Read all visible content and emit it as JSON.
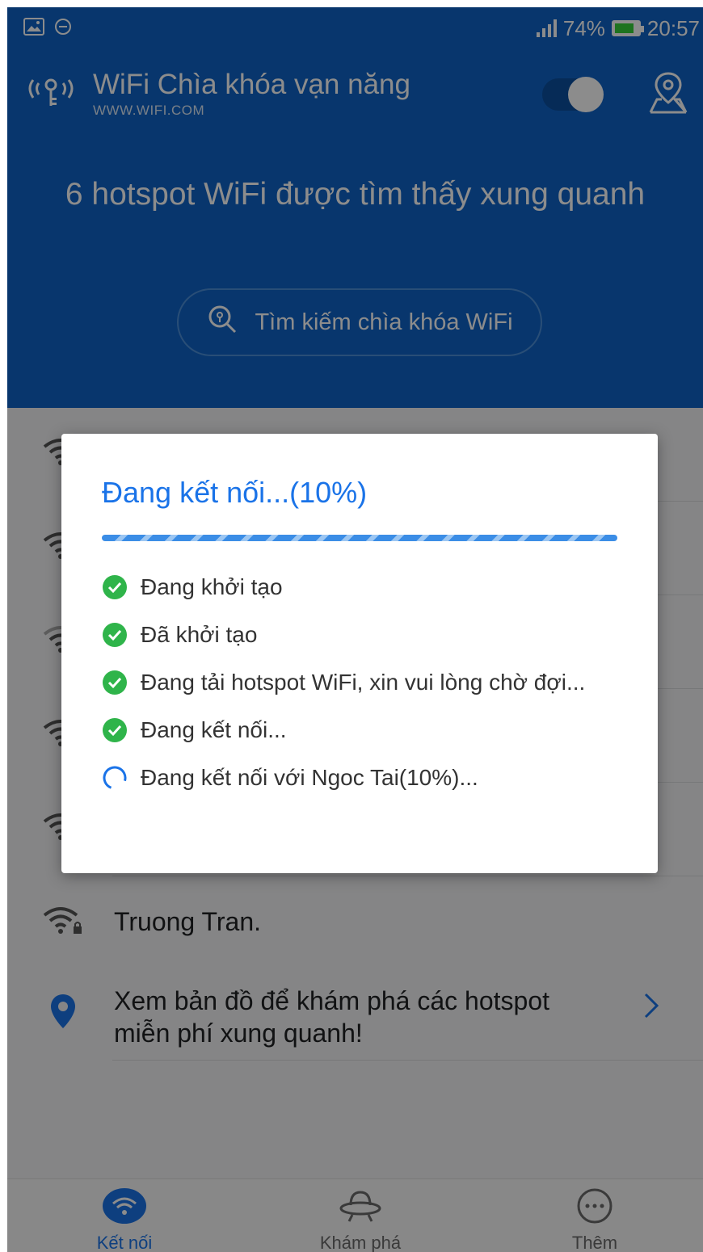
{
  "status_bar": {
    "battery": "74%",
    "time": "20:57"
  },
  "app": {
    "title": "WiFi Chìa khóa vạn năng",
    "subtitle": "WWW.WIFI.COM",
    "toggle_on": true
  },
  "hero": {
    "hotspot_count": "6 hotspot WiFi được tìm thấy xung quanh",
    "search_button": "Tìm kiếm chìa khóa WiFi"
  },
  "list": {
    "visible_network": "Truong Tran.",
    "map_prompt_line1": "Xem bản đồ để khám phá các hotspot",
    "map_prompt_line2": "miễn phí xung quanh!"
  },
  "tabs": [
    {
      "label": "Kết nối",
      "icon": "wifi-icon",
      "active": true
    },
    {
      "label": "Khám phá",
      "icon": "ufo-icon",
      "active": false
    },
    {
      "label": "Thêm",
      "icon": "more-icon",
      "active": false
    }
  ],
  "dialog": {
    "title": "Đang kết nối...(10%)",
    "progress": 0.1,
    "steps": [
      {
        "text": "Đang khởi tạo",
        "status": "done"
      },
      {
        "text": "Đã khởi tạo",
        "status": "done"
      },
      {
        "text": "Đang tải hotspot WiFi, xin vui lòng chờ đợi...",
        "status": "done"
      },
      {
        "text": "Đang kết nối...",
        "status": "done"
      },
      {
        "text": "Đang kết nối với Ngoc Tai(10%)...",
        "status": "loading"
      }
    ]
  },
  "colors": {
    "primary": "#0f63c6",
    "accent": "#1a73e8",
    "success": "#2fb44a"
  }
}
